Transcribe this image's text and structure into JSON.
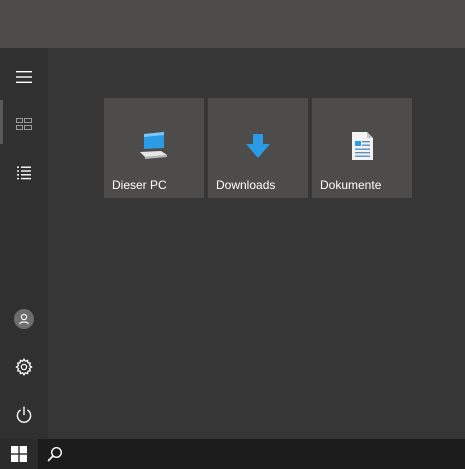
{
  "rail": {
    "items": [
      {
        "name": "menu-icon"
      },
      {
        "name": "tiles-view-icon",
        "active": true
      },
      {
        "name": "app-list-icon"
      },
      {
        "name": "user-icon"
      },
      {
        "name": "gear-icon"
      },
      {
        "name": "power-icon"
      }
    ]
  },
  "tiles": [
    {
      "label": "Dieser PC",
      "icon": "computer-icon"
    },
    {
      "label": "Downloads",
      "icon": "download-arrow-icon"
    },
    {
      "label": "Dokumente",
      "icon": "document-icon"
    }
  ],
  "taskbar": {
    "start_icon": "windows-logo-icon",
    "search_icon": "search-icon"
  },
  "colors": {
    "accent_blue": "#2b9be6",
    "tile_bg": "#4e4c4b",
    "panel_bg": "#353635",
    "rail_bg": "#2f302f",
    "taskbar_bg": "#1d1c1d"
  }
}
